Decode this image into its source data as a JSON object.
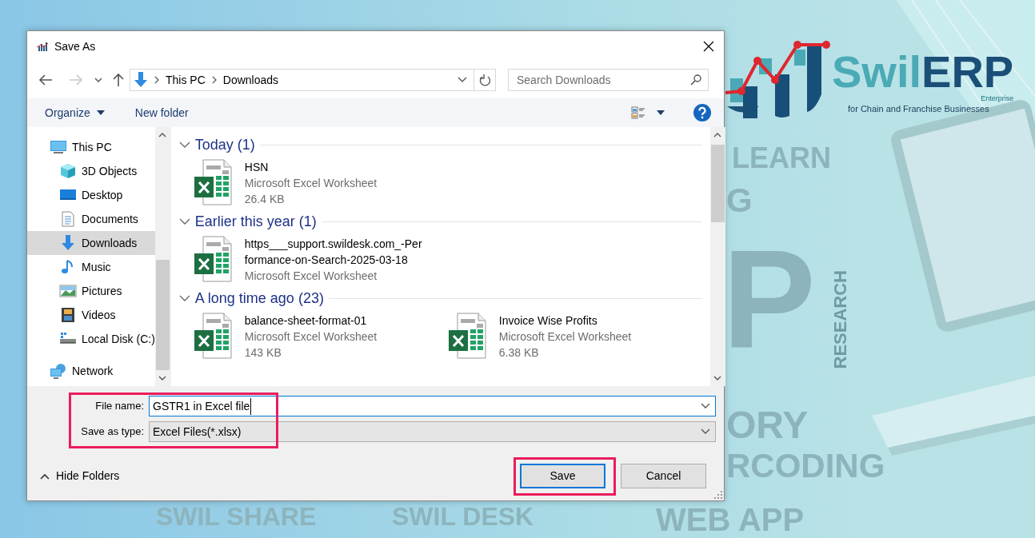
{
  "window": {
    "title": "Save As"
  },
  "address": {
    "crumbs": [
      "This PC",
      "Downloads"
    ]
  },
  "search": {
    "placeholder": "Search Downloads"
  },
  "toolbar": {
    "organize": "Organize",
    "new_folder": "New folder"
  },
  "nav": [
    {
      "label": "This PC",
      "selected": false,
      "children": [
        {
          "label": "3D Objects",
          "selected": false
        },
        {
          "label": "Desktop",
          "selected": false
        },
        {
          "label": "Documents",
          "selected": false
        },
        {
          "label": "Downloads",
          "selected": true
        },
        {
          "label": "Music",
          "selected": false
        },
        {
          "label": "Pictures",
          "selected": false
        },
        {
          "label": "Videos",
          "selected": false
        },
        {
          "label": "Local Disk (C:)",
          "selected": false
        }
      ]
    },
    {
      "label": "Network",
      "selected": false
    }
  ],
  "groups": [
    {
      "title": "Today (1)",
      "expanded": true,
      "files": [
        {
          "name_lines": [
            "HSN"
          ],
          "type": "Microsoft Excel Worksheet",
          "size": "26.4 KB"
        }
      ]
    },
    {
      "title": "Earlier this year (1)",
      "expanded": true,
      "files": [
        {
          "name_lines": [
            "https___support.swildesk.com_-Per",
            "formance-on-Search-2025-03-18"
          ],
          "type": "Microsoft Excel Worksheet"
        }
      ]
    },
    {
      "title": "A long time ago (23)",
      "expanded": true,
      "files": [
        {
          "name_lines": [
            "balance-sheet-format-01"
          ],
          "type": "Microsoft Excel Worksheet",
          "size": "143 KB"
        },
        {
          "name_lines": [
            "Invoice Wise Profits"
          ],
          "type": "Microsoft Excel Worksheet",
          "size": "6.38 KB"
        }
      ]
    }
  ],
  "file_name": {
    "label": "File name:",
    "value": "GSTR1 in Excel file"
  },
  "save_type": {
    "label": "Save as type:",
    "value": "Excel Files(*.xlsx)"
  },
  "hide_folders": "Hide Folders",
  "buttons": [
    {
      "label": "Save",
      "default": true
    },
    {
      "label": "Cancel",
      "default": false
    }
  ],
  "logo": {
    "part_1": "Swil",
    "part_2": "ERP",
    "edition": "Enterprise",
    "tagline": "for Chain and Franchise Businesses"
  },
  "background_words": [
    {
      "text": "LEARN",
      "kind": "flat"
    },
    {
      "text": "G",
      "kind": "flat"
    },
    {
      "text": "P",
      "kind": "flat"
    },
    {
      "text": "RESEARCH",
      "kind": "vertical"
    },
    {
      "text": "ORY",
      "kind": "flat"
    },
    {
      "text": "RCODING",
      "kind": "flat"
    },
    {
      "text": "SWIL SHARE",
      "kind": "flat"
    },
    {
      "text": "SWIL DESK",
      "kind": "flat"
    },
    {
      "text": "WEB APP",
      "kind": "flat"
    }
  ]
}
